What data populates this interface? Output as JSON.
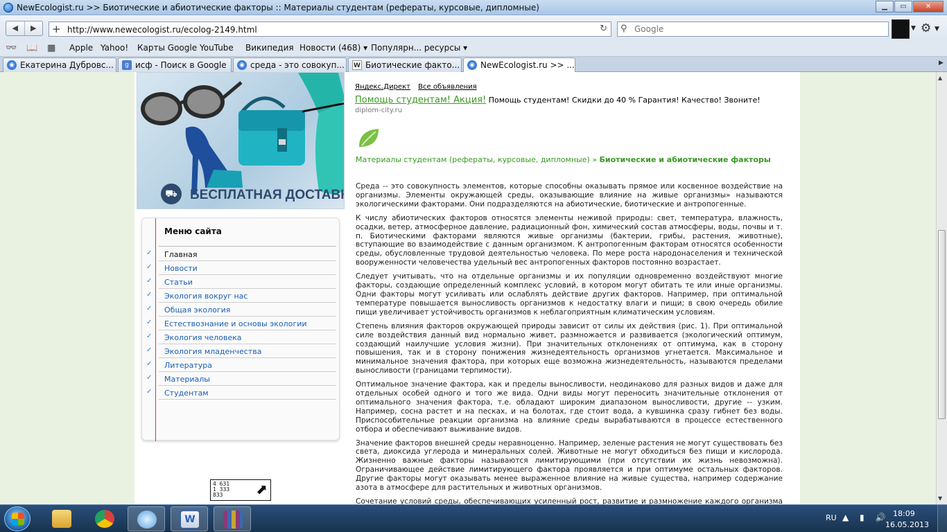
{
  "window": {
    "title": "NewEcologist.ru >> Биотические и абиотические факторы :: Материалы студентам (рефераты, курсовые, дипломные)",
    "controls": {
      "minimize": "▁",
      "maximize": "▭",
      "close": "✕"
    }
  },
  "nav": {
    "back": "◀",
    "forward": "▶",
    "url": "http://www.newecologist.ru/ecolog-2149.html",
    "search_placeholder": "Google"
  },
  "bookmarks": [
    "Apple",
    "Yahoo!",
    "Карты Google",
    "YouTube",
    "Википедия",
    "Новости (468) ▾",
    "Популярн... ресурсы ▾"
  ],
  "tabs": [
    {
      "label": "Екатерина Дубровс...",
      "icon": "globe-icon",
      "color": "#3b7dd8"
    },
    {
      "label": "исф - Поиск в Google",
      "icon": "google-icon",
      "color": "#4a7fd4"
    },
    {
      "label": "среда - это совокуп...",
      "icon": "globe-icon",
      "color": "#3b7dd8"
    },
    {
      "label": "Биотические факто...",
      "icon": "wikipedia-icon",
      "color": "#666666"
    },
    {
      "label": "NewEcologist.ru >> ...",
      "icon": "globe-icon",
      "color": "#3b7dd8"
    }
  ],
  "banner": {
    "caption": "БЕСПЛАТНАЯ ДОСТАВКА"
  },
  "menu": {
    "title": "Меню сайта",
    "items": [
      "Главная",
      "Новости",
      "Статьи",
      "Экология вокруг нас",
      "Общая экология",
      "Естествознание и основы экологии",
      "Экология человека",
      "Экология младенчества",
      "Литература",
      "Материалы",
      "Студентам"
    ]
  },
  "counter": {
    "line1": "4 631",
    "line2": "1 333",
    "line3": "833"
  },
  "ads": {
    "source": "Яндекс.Директ",
    "all_ads": "Все объявления",
    "headline": "Помощь студентам! Акция!",
    "text": "Помощь студентам! Скидки до 40 % Гарантия! Качество! Звоните!",
    "domain": "diplom-city.ru"
  },
  "breadcrumb": {
    "section": "Материалы студентам (рефераты, курсовые, дипломные)",
    "separator": " » ",
    "current": "Биотические и абиотические факторы"
  },
  "article": {
    "paragraphs": [
      "Среда -- это совокупность элементов, которые способны оказывать прямое или косвенное воздействие на организмы. Элементы окружающей среды, оказывающие влияние на живые организмы» называются экологическими факторами. Они подразделяются на абиотические, биотические и антропогенные.",
      "К числу абиотических факторов относятся элементы неживой природы: свет, температура, влажность, осадки, ветер, атмосферное давление, радиационный фон, химический состав атмосферы, воды, почвы и т. п. Биотическими факторами являются живые организмы (бактерии, грибы, растения, животные), вступающие во взаимодействие с данным организмом. К антропогенным факторам относятся особенности среды, обусловленные трудовой деятельностью человека. По мере роста народонаселения и технической вооруженности человечества удельный вес антропогенных факторов постоянно возрастает.",
      "Следует учитывать, что на отдельные организмы и их популяции одновременно воздействуют многие факторы, создающие определенный комплекс условий, в котором могут обитать те или иные организмы. Одни факторы могут усиливать или ослаблять действие других факторов. Например, при оптимальной температуре повышается выносливость организмов к недостатку влаги и пищи; в свою очередь обилие пищи увеличивает устойчивость организмов к неблагоприятным климатическим условиям.",
      "Степень влияния факторов окружающей природы зависит от силы их действия (рис. 1). При оптимальной силе воздействия данный вид нормально живет, размножается и развивается (экологический оптимум, создающий наилучшие условия жизни). При значительных отклонениях от оптимума, как в сторону повышения, так и в сторону понижения жизнедеятельность организмов угнетается. Максимальное и минимальное значения фактора, при которых еще возможна жизнедеятельность, называются пределами выносливости (границами терпимости).",
      "Оптимальное значение фактора, как и пределы выносливости, неодинаково для разных видов и даже для отдельных особей одного и того же вида. Одни виды могут переносить значительные отклонения от оптимального значения фактора, т.е. обладают широким диапазоном выносливости, другие -- узким. Например, сосна растет и на песках, и на болотах, где стоит вода, а кувшинка сразу гибнет без воды. Приспособительные реакции организма на влияние среды вырабатываются в процессе естественного отбора и обеспечивают выживание видов.",
      "Значение факторов внешней среды неравноценно. Например, зеленые растения не могут существовать без света, диоксида углерода и минеральных солей. Животные не могут обходиться без пищи и кислорода. Жизненно важные факторы называются лимитирующими (при отсутствии их жизнь невозможна). Ограничивающее действие лимитирующего фактора проявляется и при оптимуме остальных факторов. Другие факторы могут оказывать менее выраженное влияние на живые существа, например содержание азота в атмосфере для растительных и животных организмов.",
      "Сочетание условий среды, обеспечивающих усиленный рост, развитие и размножение каждого организма (популяции, вида), называют биологическим оптимумом. Создание условий биологического оптимума при выращивании сельскохозяйственных культур и животных позволяет значительно повысить их продуктивность."
    ]
  },
  "taskbar": {
    "apps": [
      {
        "name": "explorer-icon",
        "color": "#e8b845"
      },
      {
        "name": "chrome-icon",
        "color": "#d9423a"
      },
      {
        "name": "safari-icon",
        "color": "#5ba0e0"
      },
      {
        "name": "word-icon",
        "color": "#2b5fb8"
      },
      {
        "name": "winrar-icon",
        "color": "#8a3a7a"
      }
    ],
    "language": "RU",
    "time": "18:09",
    "date": "16.05.2013"
  },
  "colors": {
    "link_green": "#3a9a22",
    "link_blue": "#1a5fb4",
    "menu_rule": "#dd3333"
  }
}
